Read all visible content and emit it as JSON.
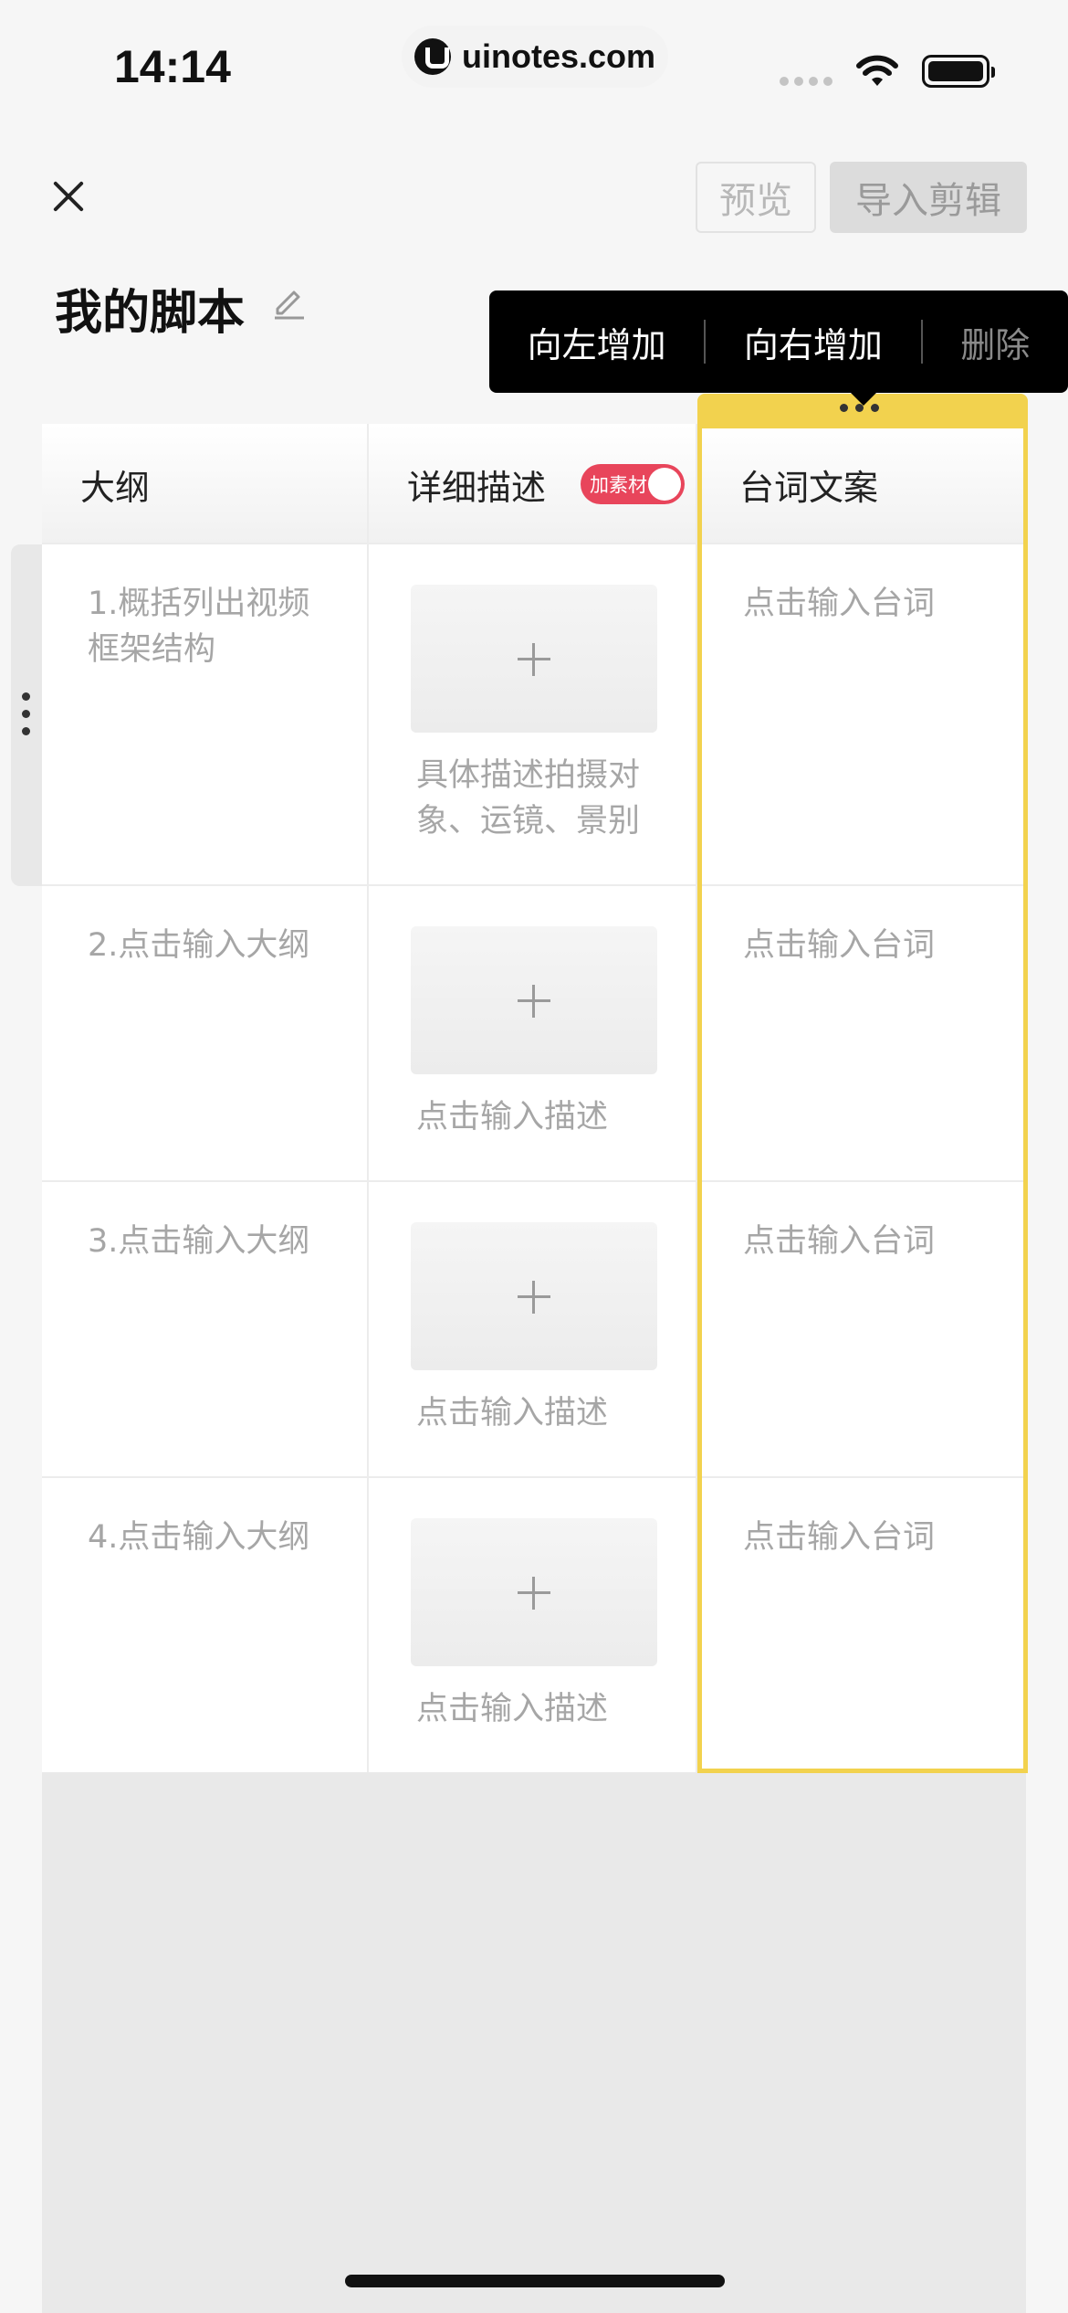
{
  "status_bar": {
    "time": "14:14",
    "url": "uinotes.com",
    "icons": [
      "signal-icon",
      "wifi-icon",
      "battery-icon"
    ]
  },
  "toolbar": {
    "close_icon": "close-icon",
    "preview_label": "预览",
    "import_label": "导入剪辑"
  },
  "page": {
    "title": "我的脚本",
    "edit_icon": "pencil-icon"
  },
  "column_menu": {
    "add_left": "向左增加",
    "add_right": "向右增加",
    "delete": "删除"
  },
  "table": {
    "headers": [
      "大纲",
      "详细描述",
      "台词文案"
    ],
    "material_toggle_label": "加素材",
    "material_toggle_on": true,
    "rows": [
      {
        "outline": "1.概括列出视频框架结构",
        "description": "具体描述拍摄对象、运镜、景别",
        "line": "点击输入台词"
      },
      {
        "outline": "2.点击输入大纲",
        "description": "点击输入描述",
        "line": "点击输入台词"
      },
      {
        "outline": "3.点击输入大纲",
        "description": "点击输入描述",
        "line": "点击输入台词"
      },
      {
        "outline": "4.点击输入大纲",
        "description": "点击输入描述",
        "line": "点击输入台词"
      }
    ]
  },
  "colors": {
    "highlight": "#f2d24e",
    "toggle": "#e8455b",
    "popup_bg": "#000000"
  }
}
